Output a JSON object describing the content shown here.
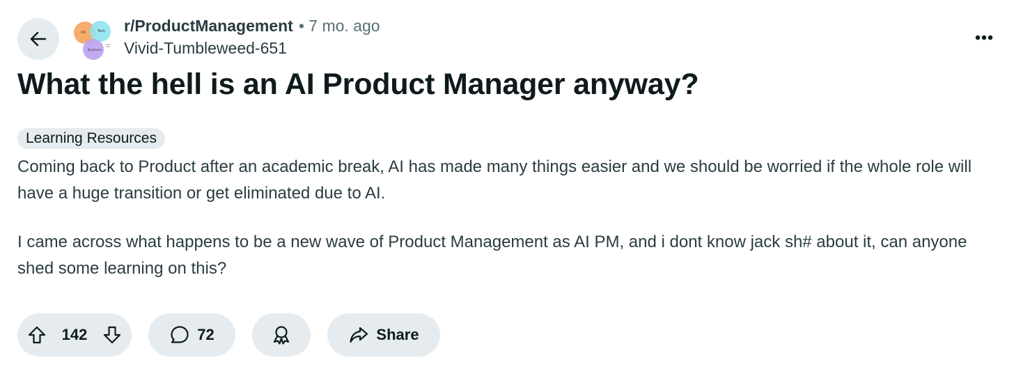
{
  "header": {
    "subreddit": "r/ProductManagement",
    "time": "• 7 mo. ago",
    "username": "Vivid-Tumbleweed-651",
    "avatar": {
      "circle_labels": [
        "UX",
        "Tech",
        "Business"
      ],
      "colors": [
        "#f7a35c",
        "#8fe3ef",
        "#b9a2f0"
      ]
    }
  },
  "post": {
    "title": "What the hell is an AI Product Manager anyway?",
    "flair": "Learning Resources",
    "paragraphs": [
      "Coming back to Product after an academic break, AI has made many things easier and we should be worried if the whole role will have a huge transition or get eliminated due to AI.",
      "I came across what happens to be a new wave of Product Management as AI PM, and i dont know jack sh# about it, can anyone shed some learning on this?"
    ]
  },
  "actions": {
    "votes": "142",
    "comments": "72",
    "share_label": "Share"
  },
  "icons": {
    "back": "arrow-left-icon",
    "more": "more-horizontal-icon",
    "upvote": "arrow-up-icon",
    "downvote": "arrow-down-icon",
    "comment": "comment-bubble-icon",
    "award": "award-icon",
    "share": "share-arrow-icon"
  },
  "theme": {
    "button_bg": "#e5ebee",
    "text_primary": "#0f1a1c",
    "text_secondary": "#576f76"
  }
}
